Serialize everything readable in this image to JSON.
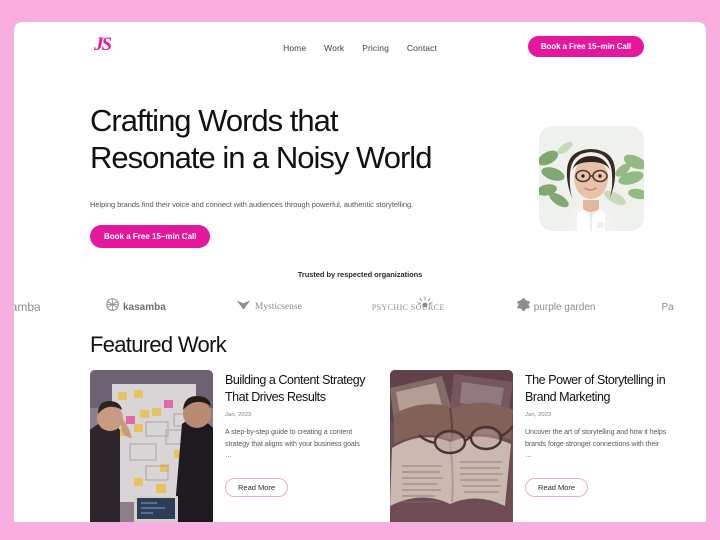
{
  "theme": {
    "page_background": "#f9aee0",
    "surface": "#ffffff",
    "accent": "#e5179c",
    "accent_soft": "#f0a9d6",
    "text_primary": "#111114",
    "text_muted": "#55555e",
    "logo_gray": "#8b8b93"
  },
  "header": {
    "logo_text": "JS",
    "nav": [
      {
        "label": "Home"
      },
      {
        "label": "Work"
      },
      {
        "label": "Pricing"
      },
      {
        "label": "Contact"
      }
    ],
    "cta_label": "Book a Free 15–min Call"
  },
  "hero": {
    "title_line1": "Crafting Words that",
    "title_line2": "Resonate in a Noisy World",
    "subtitle": "Helping brands find their voice and connect with audiences through powerful, authentic storytelling.",
    "cta_label": "Book a Free 15–min Call",
    "portrait_alt": "portrait of woman with glasses in white shirt against green foliage"
  },
  "trusted": {
    "label": "Trusted by respected organizations",
    "logos": [
      {
        "name": "kasamba",
        "icon": "circular-weave-icon",
        "clipped": true
      },
      {
        "name": "Mysticsense",
        "icon": "bird-triangle-icon"
      },
      {
        "name": "PSYCHIC SOURCE",
        "icon": "sun-rays-icon"
      },
      {
        "name": "purple garden",
        "icon": "round-bloom-icon"
      },
      {
        "name": "Pa",
        "icon": "",
        "clipped": true
      }
    ]
  },
  "featured": {
    "heading": "Featured Work",
    "cards": [
      {
        "title": "Building a Content Strategy That Drives Results",
        "date": "Jan, 2023",
        "excerpt": "A step-by-step guide to creating a content strategy that aligns with your business goals …",
        "read_more_label": "Read More",
        "thumb_alt": "two people planning at a whiteboard covered with sticky notes"
      },
      {
        "title": "The Power of Storytelling in Brand Marketing",
        "date": "Jan, 2023",
        "excerpt": "Uncover the art of storytelling and how it helps brands forge stronger connections with their …",
        "read_more_label": "Read More",
        "thumb_alt": "open books with a pair of eyeglasses resting on a page"
      }
    ]
  }
}
